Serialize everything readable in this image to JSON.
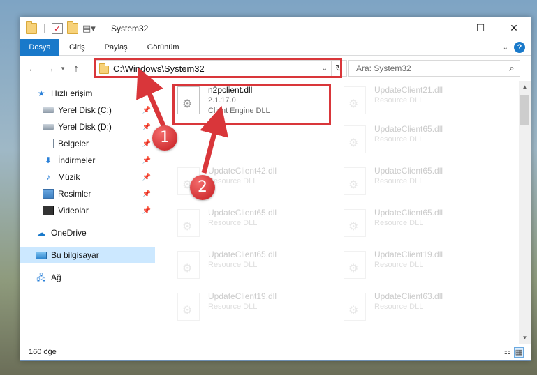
{
  "window": {
    "title": "System32",
    "controls": {
      "minimize": "—",
      "maximize": "☐",
      "close": "✕"
    }
  },
  "ribbon": {
    "tabs": [
      "Dosya",
      "Giriş",
      "Paylaş",
      "Görünüm"
    ]
  },
  "address": {
    "path": "C:\\Windows\\System32",
    "search_placeholder": "Ara: System32"
  },
  "nav": {
    "items": [
      {
        "label": "Hızlı erişim",
        "icon": "star-icon"
      },
      {
        "label": "Yerel Disk (C:)",
        "icon": "disk-icon",
        "pinned": true
      },
      {
        "label": "Yerel Disk (D:)",
        "icon": "disk-icon",
        "pinned": true
      },
      {
        "label": "Belgeler",
        "icon": "document-icon",
        "pinned": true
      },
      {
        "label": "İndirmeler",
        "icon": "download-icon",
        "pinned": true
      },
      {
        "label": "Müzik",
        "icon": "music-icon",
        "pinned": true
      },
      {
        "label": "Resimler",
        "icon": "pictures-icon",
        "pinned": true
      },
      {
        "label": "Videolar",
        "icon": "video-icon",
        "pinned": true
      },
      {
        "label": "OneDrive",
        "icon": "cloud-icon"
      },
      {
        "label": "Bu bilgisayar",
        "icon": "computer-icon",
        "selected": true
      },
      {
        "label": "Ağ",
        "icon": "network-icon"
      }
    ]
  },
  "files": {
    "highlighted": {
      "name": "n2pclient.dll",
      "version": "2.1.17.0",
      "description": "Client Engine DLL"
    },
    "left_column": [
      {
        "name": "UpdateClient42.dll",
        "description": "Resource DLL"
      },
      {
        "name": "UpdateClient65.dll",
        "description": "Resource DLL"
      },
      {
        "name": "UpdateClient65.dll",
        "description": "Resource DLL"
      },
      {
        "name": "UpdateClient19.dll",
        "description": "Resource DLL"
      }
    ],
    "right_column": [
      {
        "name": "UpdateClient21.dll",
        "description": "Resource DLL"
      },
      {
        "name": "UpdateClient65.dll",
        "description": "Resource DLL"
      },
      {
        "name": "UpdateClient65.dll",
        "description": "Resource DLL"
      },
      {
        "name": "UpdateClient65.dll",
        "description": "Resource DLL"
      },
      {
        "name": "UpdateClient19.dll",
        "description": "Resource DLL"
      },
      {
        "name": "UpdateClient63.dll",
        "description": "Resource DLL"
      }
    ]
  },
  "status": {
    "item_count": "160 öğe"
  },
  "annotations": {
    "step1": "1",
    "step2": "2",
    "highlight_color": "#d9363a"
  }
}
